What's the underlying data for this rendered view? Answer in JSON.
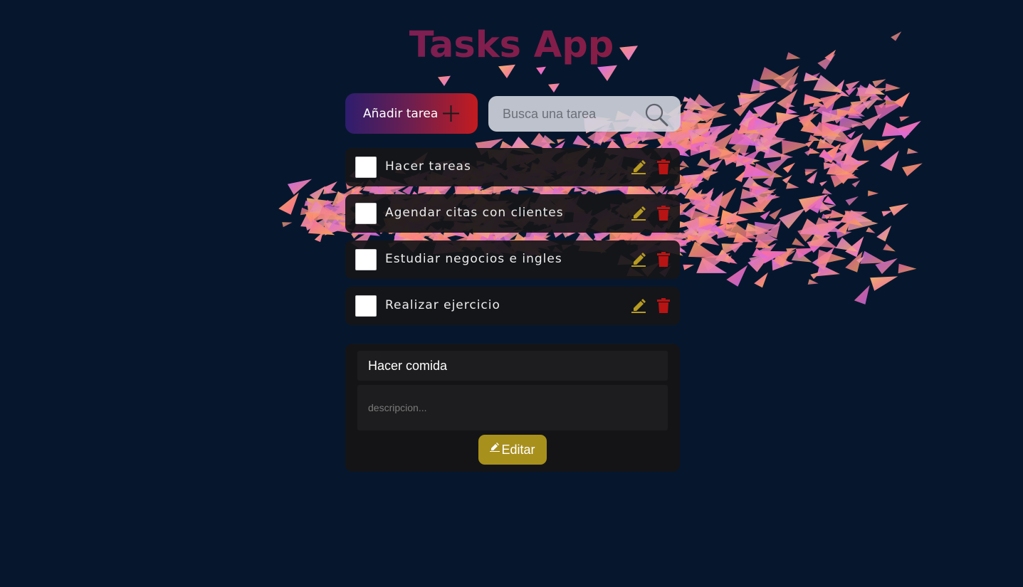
{
  "app": {
    "title": "Tasks App"
  },
  "toolbar": {
    "add_label": "Añadir tarea",
    "add_icon": "plus-icon",
    "search_placeholder": "Busca una tarea",
    "search_value": "",
    "search_icon": "search-icon"
  },
  "tasks": [
    {
      "label": "Hacer tareas",
      "done": false
    },
    {
      "label": "Agendar citas con clientes",
      "done": false
    },
    {
      "label": "Estudiar negocios e ingles",
      "done": false
    },
    {
      "label": "Realizar ejercicio",
      "done": false
    }
  ],
  "edit_form": {
    "title_value": "Hacer comida",
    "description_placeholder": "descripcion...",
    "description_value": "",
    "submit_label": "Editar"
  },
  "colors": {
    "background": "#06172d",
    "edit_icon": "#b79b22",
    "delete_icon": "#b81414",
    "submit_button": "#a8901d"
  }
}
